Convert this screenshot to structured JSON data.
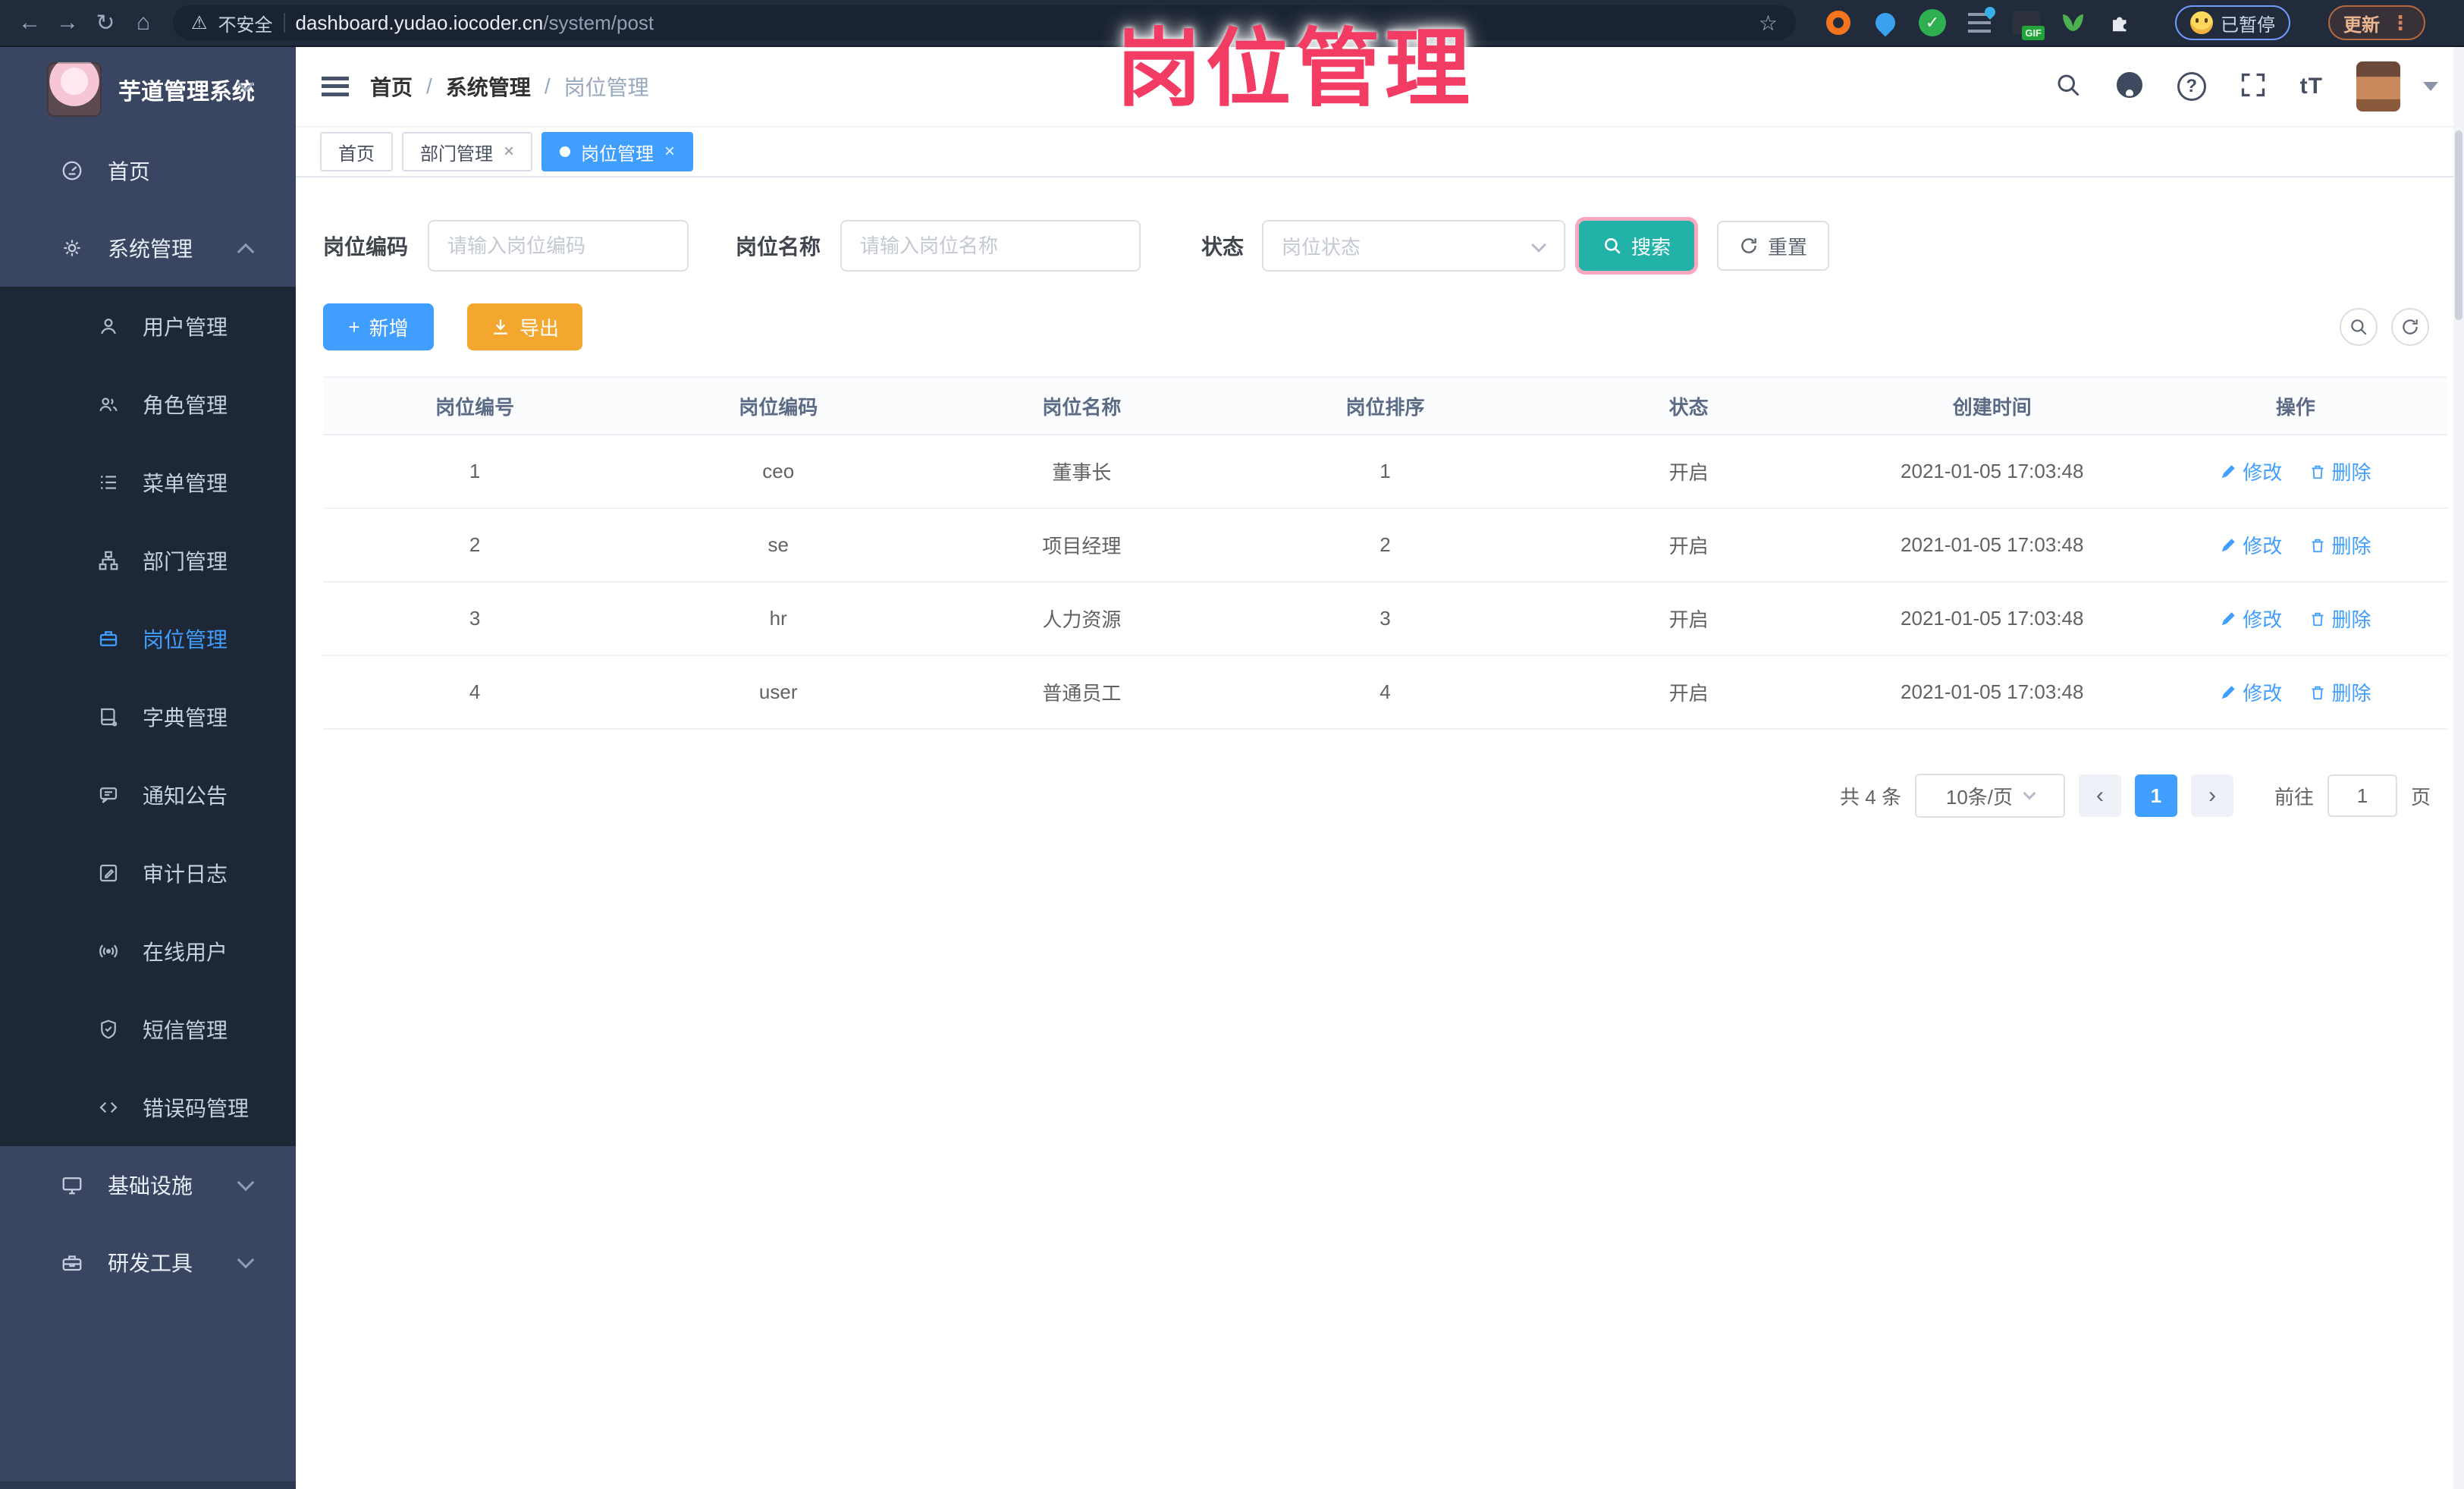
{
  "browser": {
    "security_label": "不安全",
    "url_domain": "dashboard.yudao.iocoder.cn",
    "url_path": "/system/post",
    "paused_label": "已暂停",
    "update_label": "更新",
    "gif_label": "GIF"
  },
  "glyphs": {
    "back": "←",
    "forward": "→",
    "reload": "↻",
    "home": "⌂",
    "warning": "⚠",
    "star": "☆",
    "dots": "⋮",
    "slash": "/",
    "close": "×",
    "plus": "+",
    "prev": "‹",
    "next": "›",
    "question": "?",
    "font_size": "tT"
  },
  "annotation": {
    "title": "岗位管理",
    "color": "#f23c64"
  },
  "sidebar": {
    "app_title": "芋道管理系统",
    "home_label": "首页",
    "system_label": "系统管理",
    "system_children": [
      "用户管理",
      "角色管理",
      "菜单管理",
      "部门管理",
      "岗位管理",
      "字典管理",
      "通知公告",
      "审计日志",
      "在线用户",
      "短信管理",
      "错误码管理"
    ],
    "active_item": "岗位管理",
    "infra_label": "基础设施",
    "devtools_label": "研发工具"
  },
  "header": {
    "breadcrumb": [
      "首页",
      "系统管理",
      "岗位管理"
    ]
  },
  "tabs": {
    "items": [
      "首页",
      "部门管理",
      "岗位管理"
    ],
    "active": "岗位管理"
  },
  "filters": {
    "code_label": "岗位编码",
    "code_placeholder": "请输入岗位编码",
    "name_label": "岗位名称",
    "name_placeholder": "请输入岗位名称",
    "status_label": "状态",
    "status_placeholder": "岗位状态",
    "search_label": "搜索",
    "reset_label": "重置"
  },
  "toolbar": {
    "add_label": "新增",
    "export_label": "导出"
  },
  "table": {
    "headers": [
      "岗位编号",
      "岗位编码",
      "岗位名称",
      "岗位排序",
      "状态",
      "创建时间",
      "操作"
    ],
    "edit_label": "修改",
    "delete_label": "删除",
    "rows": [
      {
        "id": "1",
        "code": "ceo",
        "name": "董事长",
        "sort": "1",
        "status": "开启",
        "created": "2021-01-05 17:03:48"
      },
      {
        "id": "2",
        "code": "se",
        "name": "项目经理",
        "sort": "2",
        "status": "开启",
        "created": "2021-01-05 17:03:48"
      },
      {
        "id": "3",
        "code": "hr",
        "name": "人力资源",
        "sort": "3",
        "status": "开启",
        "created": "2021-01-05 17:03:48"
      },
      {
        "id": "4",
        "code": "user",
        "name": "普通员工",
        "sort": "4",
        "status": "开启",
        "created": "2021-01-05 17:03:48"
      }
    ]
  },
  "pagination": {
    "total_label": "共 4 条",
    "page_size_label": "10条/页",
    "current_page": "1",
    "goto_label": "前往",
    "goto_value": "1",
    "unit_label": "页"
  },
  "colors": {
    "accent": "#409eff",
    "search_button": "#23b2a7",
    "export_button": "#f3a72e",
    "annotation": "#f23c64",
    "sidebar_bg": "#3a4661",
    "submenu_bg": "#1e2736"
  }
}
